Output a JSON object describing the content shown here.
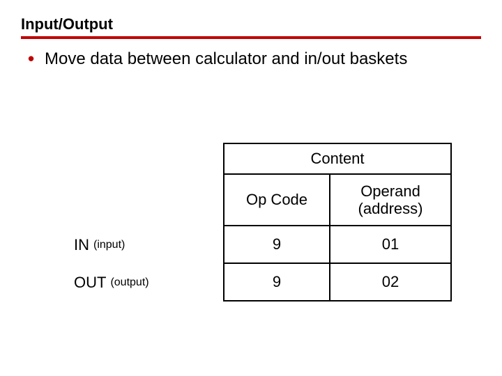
{
  "title": "Input/Output",
  "bullet_text": "Move data between calculator and in/out baskets",
  "table": {
    "content_label": "Content",
    "header_opcode": "Op Code",
    "header_operand_l1": "Operand",
    "header_operand_l2": "(address)",
    "rows": [
      {
        "label_main": "IN",
        "label_sub": "(input)",
        "opcode": "9",
        "operand": "01"
      },
      {
        "label_main": "OUT",
        "label_sub": "(output)",
        "opcode": "9",
        "operand": "02"
      }
    ]
  }
}
